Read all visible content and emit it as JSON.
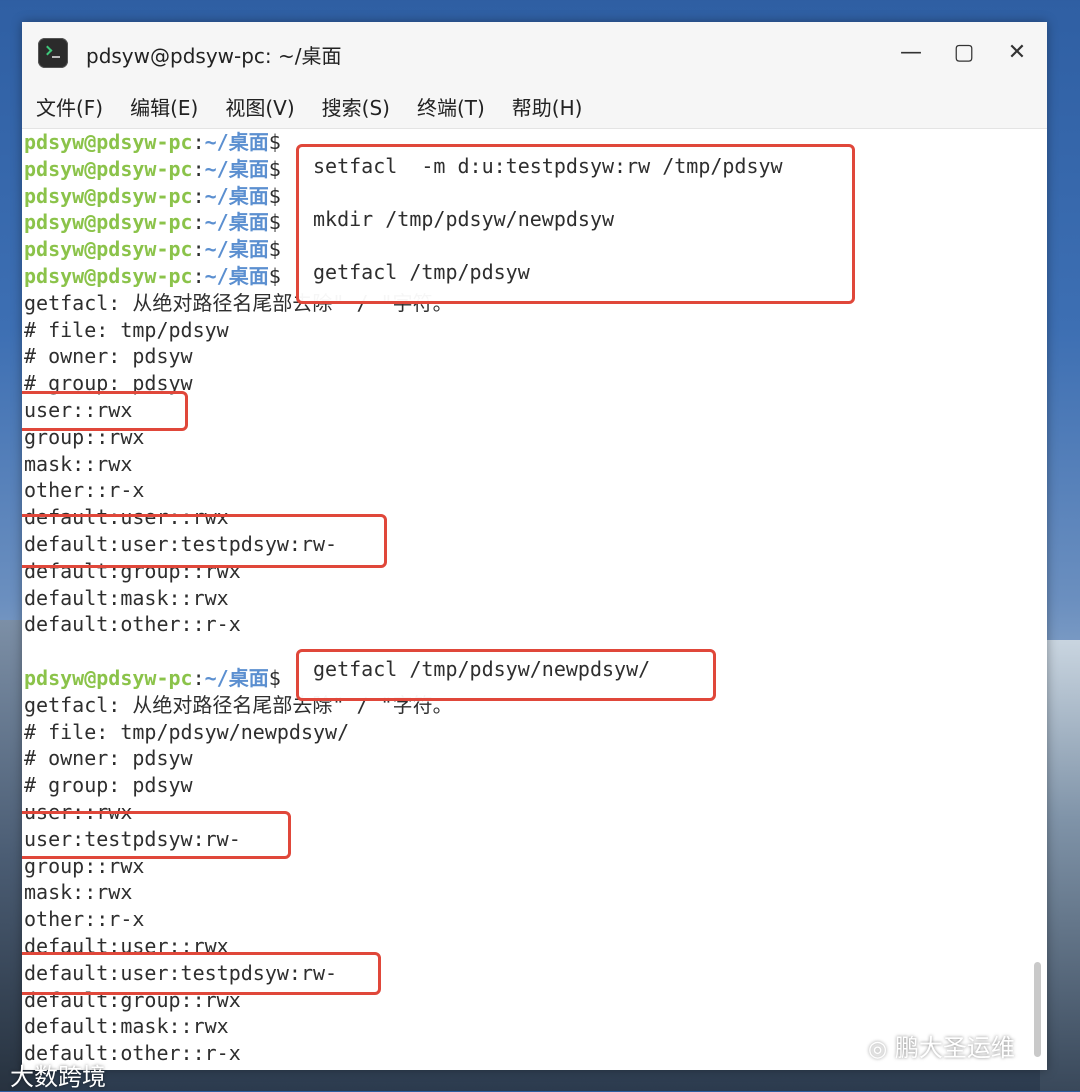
{
  "window": {
    "title": "pdsyw@pdsyw-pc: ~/桌面"
  },
  "menu": [
    "文件(F)",
    "编辑(E)",
    "视图(V)",
    "搜索(S)",
    "终端(T)",
    "帮助(H)"
  ],
  "prompt": {
    "user": "pdsyw@pdsyw-pc",
    "colon": ":",
    "path": "~/桌面",
    "dollar": "$"
  },
  "commands_box1": [
    "setfacl  -m d:u:testpdsyw:rw /tmp/pdsyw",
    "mkdir /tmp/pdsyw/newpdsyw",
    "getfacl /tmp/pdsyw"
  ],
  "output1": [
    "getfacl: 从绝对路径名尾部去除\" / \"字符。",
    "# file: tmp/pdsyw",
    "# owner: pdsyw",
    "# group: pdsyw",
    "user::rwx",
    "group::rwx",
    "mask::rwx",
    "other::r-x",
    "default:user::rwx",
    "default:user:testpdsyw:rw-",
    "default:group::rwx",
    "default:mask::rwx",
    "default:other::r-x"
  ],
  "command2": "getfacl /tmp/pdsyw/newpdsyw/",
  "output2": [
    "getfacl: 从绝对路径名尾部去除\" / \"字符。",
    "# file: tmp/pdsyw/newpdsyw/",
    "# owner: pdsyw",
    "# group: pdsyw",
    "user::rwx",
    "user:testpdsyw:rw-",
    "group::rwx",
    "mask::rwx",
    "other::r-x",
    "default:user::rwx",
    "default:user:testpdsyw:rw-",
    "default:group::rwx",
    "default:mask::rwx",
    "default:other::r-x"
  ],
  "watermarks": {
    "left": "大数跨境",
    "right": "鹏大圣运维"
  },
  "colors": {
    "highlight": "#e0473a",
    "prompt_user": "#8bc34a",
    "prompt_path": "#5b8fd0"
  }
}
